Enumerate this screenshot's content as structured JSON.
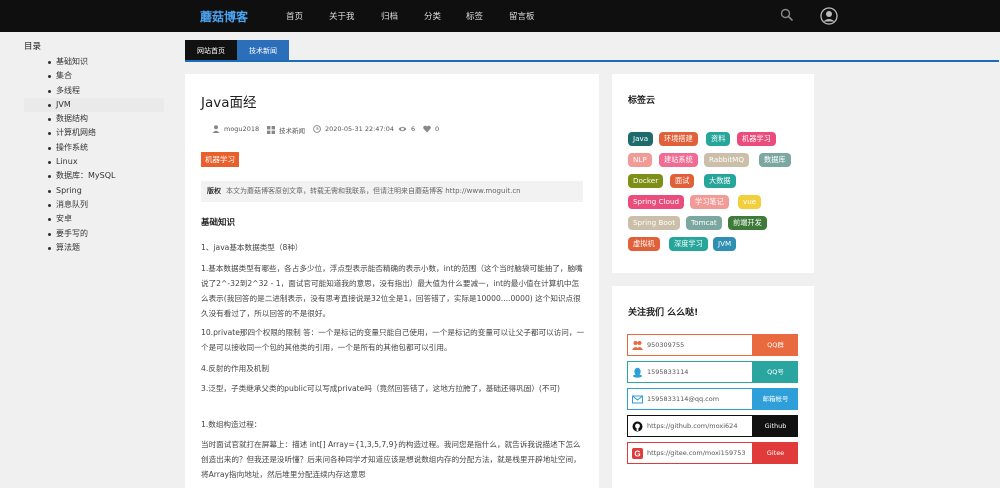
{
  "nav": {
    "logo": "蘑菇博客",
    "items": [
      "首页",
      "关于我",
      "归档",
      "分类",
      "标签",
      "留言板"
    ]
  },
  "toc": {
    "title": "目录",
    "items": [
      "基础知识",
      "集合",
      "多线程",
      "JVM",
      "数据结构",
      "计算机网络",
      "操作系统",
      "Linux",
      "数据库：MySQL",
      "Spring",
      "消息队列",
      "安卓",
      "要手写的",
      "算法题"
    ],
    "active_index": 3
  },
  "tabs": [
    "网站首页",
    "技术新闻"
  ],
  "article": {
    "title": "Java面经",
    "author": "mogu2018",
    "category": "技术新闻",
    "datetime": "2020-05-31 22:47:04",
    "views": "6",
    "likes": "0",
    "tag": "机器学习",
    "copyright_label": "版权",
    "copyright_text": "本文为蘑菇博客原创文章，转载无需和我联系，但请注明来自蘑菇博客 http://www.moguit.cn",
    "section_heading": "基础知识",
    "paragraphs": [
      "1、java基本数据类型（8种）",
      "1.基本数据类型有哪些，各占多少位，浮点型表示能否精确的表示小数，int的范围（这个当时脑袋可能抽了，脑嘴说了2^-32到2^32 - 1，面试官可能知道我的意思，没有指出）最大值为什么要减一，int的最小值在计算机中怎么表示(我回答的是二进制表示，没有思考直接说是32位全是1，回答错了，实际是10000....0000) 这个知识点很久没有看过了，所以回答的不是很好。",
      "10.private那四个权限的限制 答：一个是标记的变量只能自己使用，一个是标记的变量可以让父子都可以访问，一个是可以接收同一个包的其他类的引用，一个是所有的其他包都可以引用。",
      "4.反射的作用及机制",
      "3.泛型，子类继承父类的public可以写成private吗（竟然回答错了，这地方拉胯了，基础还得巩固）(不可)",
      "1.数组构造过程：",
      "当时面试官就打在屏幕上：描述 int[] Array={1,3,5,7,9}的构造过程。我问您是指什么，就告诉我说描述下怎么创造出来的？但我还是没听懂？后来问各种同学才知道应该是想说数组内存的分配方法，就是栈里开辟地址空间，将Array指向地址，然后堆里分配连续内存这意思"
    ]
  },
  "tagcloud": {
    "title": "标签云",
    "tags": [
      {
        "label": "Java",
        "color": "#1e6b6b"
      },
      {
        "label": "环境搭建",
        "color": "#e0603a"
      },
      {
        "label": "资料",
        "color": "#26a69a"
      },
      {
        "label": "机器学习",
        "color": "#ea4c7b"
      },
      {
        "label": "NLP",
        "color": "#f19a96"
      },
      {
        "label": "建站系统",
        "color": "#f06c95"
      },
      {
        "label": "RabbitMQ",
        "color": "#cbbfa9"
      },
      {
        "label": "数据库",
        "color": "#7aa8a0"
      },
      {
        "label": "Docker",
        "color": "#7d8f16"
      },
      {
        "label": "面试",
        "color": "#e0603a"
      },
      {
        "label": "大数据",
        "color": "#26a69a"
      },
      {
        "label": "Spring Cloud",
        "color": "#ea4c7b"
      },
      {
        "label": "学习笔记",
        "color": "#f19a96"
      },
      {
        "label": "vue",
        "color": "#f2cf3c"
      },
      {
        "label": "Spring Boot",
        "color": "#cbbfa9"
      },
      {
        "label": "Tomcat",
        "color": "#7aa8a0"
      },
      {
        "label": "前端开发",
        "color": "#3e7a3a"
      },
      {
        "label": "虚拟机",
        "color": "#e0603a"
      },
      {
        "label": "深度学习",
        "color": "#26a69a"
      },
      {
        "label": "JVM",
        "color": "#2e8fb3"
      }
    ]
  },
  "follow": {
    "title": "关注我们 么么哒!",
    "rows": [
      {
        "icon": "people-icon",
        "text": "950309755",
        "button": "QQ群",
        "color": "#e86a3e"
      },
      {
        "icon": "qq-icon",
        "text": "1595833114",
        "button": "QQ号",
        "color": "#2ba59f"
      },
      {
        "icon": "mail-icon",
        "text": "1595833114@qq.com",
        "button": "邮箱帐号",
        "color": "#2e9fd9"
      },
      {
        "icon": "github-icon",
        "text": "https://github.com/moxi624",
        "button": "Github",
        "color": "#111111"
      },
      {
        "icon": "gitee-icon",
        "text": "https://gitee.com/moxi159753",
        "button": "Gitee",
        "color": "#e03a3a"
      }
    ]
  }
}
